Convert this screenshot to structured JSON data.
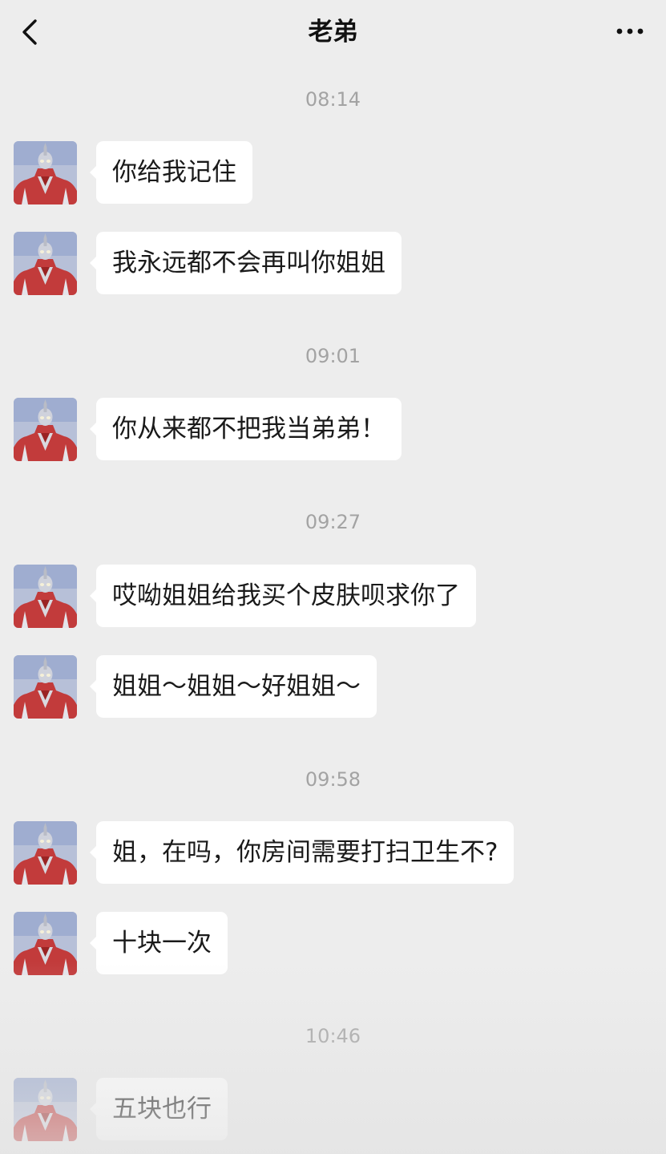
{
  "header": {
    "title": "老弟",
    "back_icon": "chevron-left-icon",
    "more_icon": "more-dots-icon"
  },
  "colors": {
    "background": "#ededed",
    "bubble": "#ffffff",
    "timestamp": "#a3a3a3"
  },
  "chat": {
    "timestamps": [
      "08:14",
      "09:01",
      "09:27",
      "09:58",
      "10:46"
    ],
    "messages": [
      {
        "text": "你给我记住",
        "sender": "received"
      },
      {
        "text": "我永远都不会再叫你姐姐",
        "sender": "received"
      },
      {
        "text": "你从来都不把我当弟弟！",
        "sender": "received"
      },
      {
        "text": "哎呦姐姐给我买个皮肤呗求你了",
        "sender": "received"
      },
      {
        "text": "姐姐～姐姐～好姐姐～",
        "sender": "received"
      },
      {
        "text": "姐，在吗，你房间需要打扫卫生不?",
        "sender": "received"
      },
      {
        "text": "十块一次",
        "sender": "received"
      },
      {
        "text": "五块也行",
        "sender": "received"
      }
    ],
    "avatar_icon": "red-silver-hero-avatar"
  }
}
